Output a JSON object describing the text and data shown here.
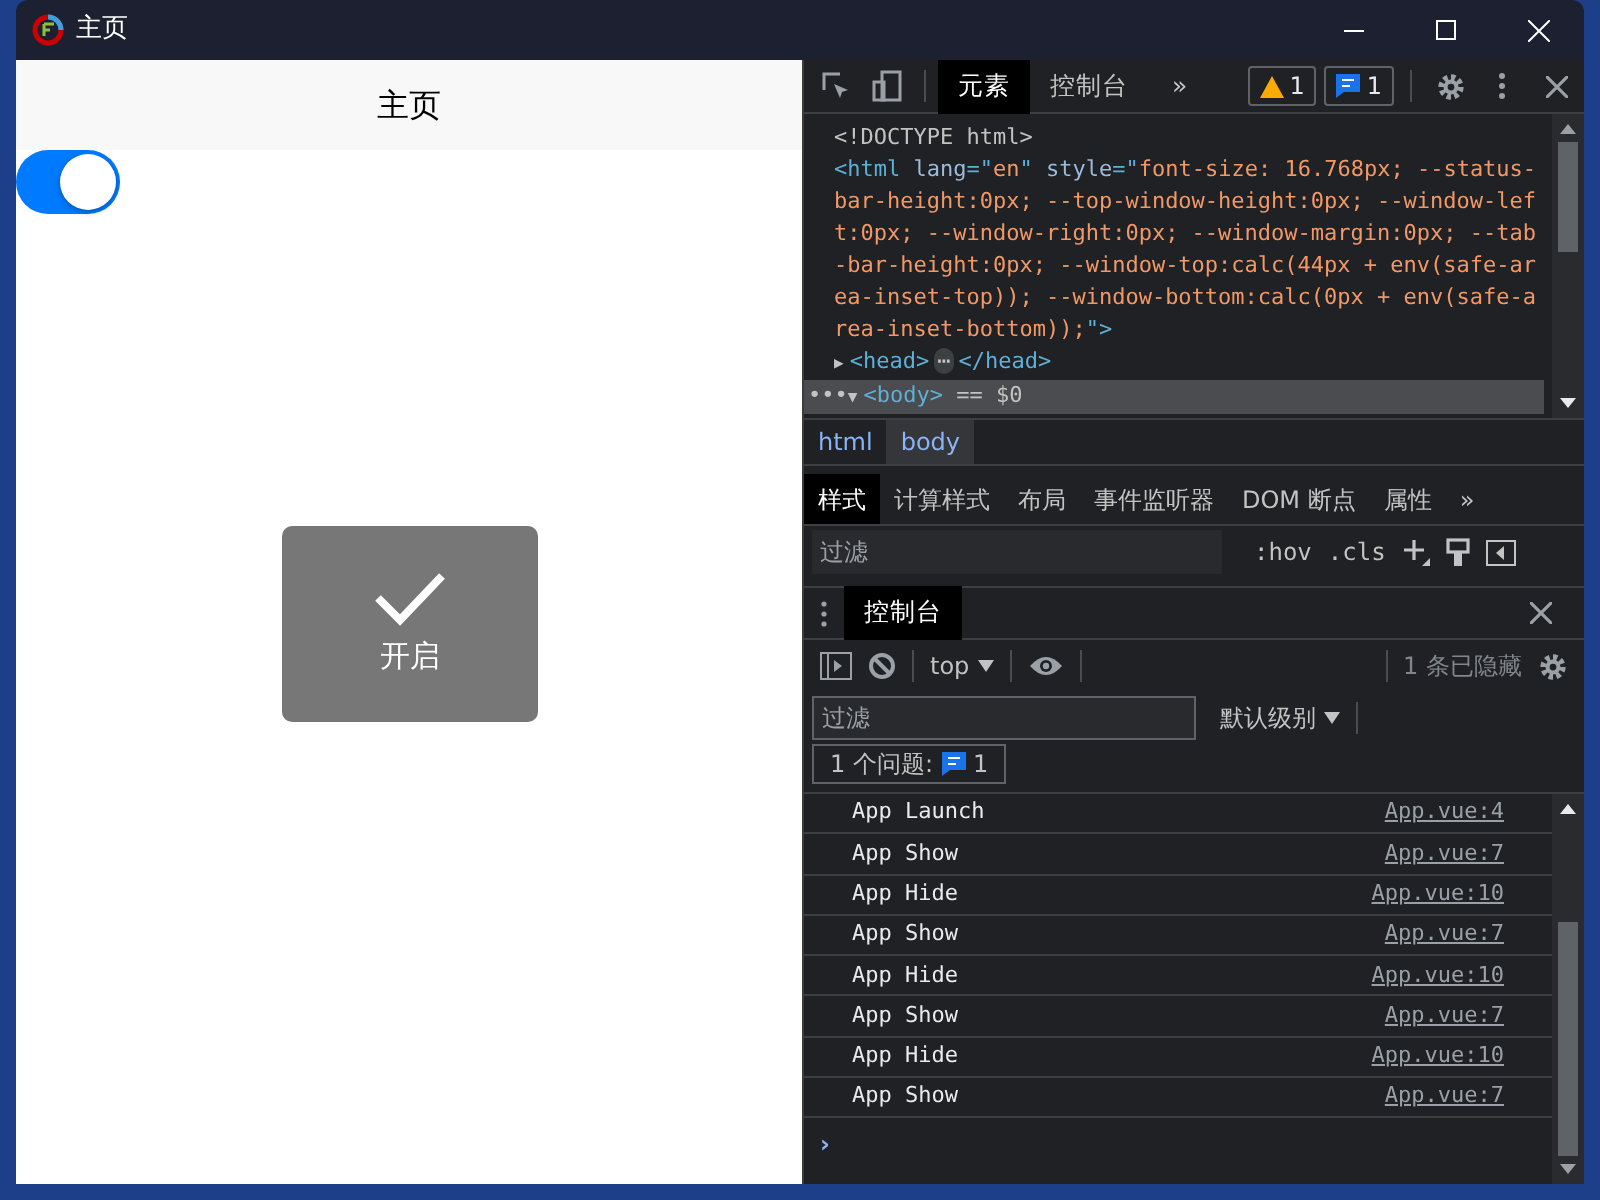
{
  "window": {
    "title": "主页"
  },
  "app": {
    "nav_title": "主页",
    "switch": {
      "on": true
    },
    "toast": {
      "label": "开启"
    }
  },
  "devtools": {
    "tabs": [
      {
        "label": "元素",
        "selected": true
      },
      {
        "label": "控制台",
        "selected": false
      }
    ],
    "more_tabs": "»",
    "warning_count": "1",
    "message_count": "1",
    "dom": [
      {
        "kind": "doctype",
        "tokens": [
          {
            "kind": "plain",
            "text": "<!DOCTYPE html>"
          }
        ]
      },
      {
        "kind": "element",
        "tokens": [
          {
            "kind": "tag",
            "text": "<html"
          },
          {
            "kind": "attr",
            "text": " lang"
          },
          {
            "kind": "tag",
            "text": "=\""
          },
          {
            "kind": "value",
            "text": "en"
          },
          {
            "kind": "tag",
            "text": "\""
          },
          {
            "kind": "attr",
            "text": " style"
          },
          {
            "kind": "tag",
            "text": "=\""
          },
          {
            "kind": "value",
            "text": "font-size: 16.768px; --status-bar-height:0px; --top-window-height:0px; --window-left:0px; --window-right:0px; --window-margin:0px; --tab-bar-height:0px; --window-top:calc(44px + env(safe-area-inset-top)); --window-bottom:calc(0px + env(safe-area-inset-bottom));"
          },
          {
            "kind": "tag",
            "text": "\">"
          }
        ]
      },
      {
        "kind": "collapsed",
        "tokens": [
          {
            "kind": "arrow",
            "text": "▶"
          },
          {
            "kind": "tag",
            "text": "<head>"
          },
          {
            "kind": "badge",
            "text": "⋯"
          },
          {
            "kind": "tag",
            "text": "</head>"
          }
        ]
      },
      {
        "kind": "selected",
        "tokens": [
          {
            "kind": "plain",
            "text": "•••"
          },
          {
            "kind": "arrow",
            "text": "▼"
          },
          {
            "kind": "tag",
            "text": "<body>"
          },
          {
            "kind": "plain",
            "text": " == $0"
          }
        ]
      }
    ],
    "breadcrumbs": [
      {
        "label": "html",
        "selected": false
      },
      {
        "label": "body",
        "selected": true
      }
    ],
    "style_tabs": [
      {
        "label": "样式",
        "selected": true
      },
      {
        "label": "计算样式",
        "selected": false
      },
      {
        "label": "布局",
        "selected": false
      },
      {
        "label": "事件监听器",
        "selected": false
      },
      {
        "label": "DOM 断点",
        "selected": false
      },
      {
        "label": "属性",
        "selected": false
      }
    ],
    "more_style_tabs": "»",
    "styles_filter": {
      "placeholder": "过滤"
    },
    "hov": ":hov",
    "cls": ".cls",
    "drawer_tabs": [
      {
        "label": "控制台",
        "selected": true
      }
    ],
    "context": "top",
    "hidden_count": "1 条已隐藏",
    "console_filter": {
      "placeholder": "过滤"
    },
    "log_level": "默认级别",
    "issues": {
      "label": "1 个问题:",
      "count": "1"
    },
    "logs": [
      {
        "message": "App Launch",
        "source": "App.vue:4"
      },
      {
        "message": "App Show",
        "source": "App.vue:7"
      },
      {
        "message": "App Hide",
        "source": "App.vue:10"
      },
      {
        "message": "App Show",
        "source": "App.vue:7"
      },
      {
        "message": "App Hide",
        "source": "App.vue:10"
      },
      {
        "message": "App Show",
        "source": "App.vue:7"
      },
      {
        "message": "App Hide",
        "source": "App.vue:10"
      },
      {
        "message": "App Show",
        "source": "App.vue:7"
      }
    ],
    "prompt": "›"
  }
}
